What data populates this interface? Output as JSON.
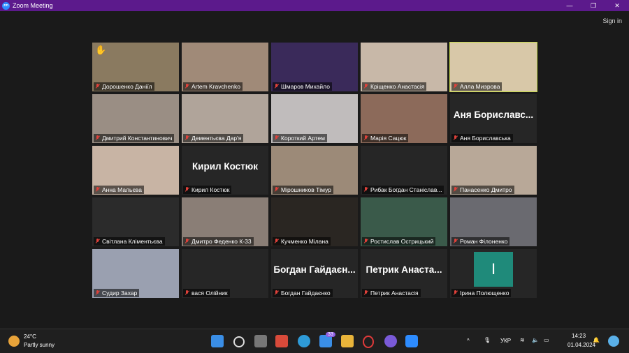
{
  "window": {
    "title": "Zoom Meeting",
    "signin": "Sign in"
  },
  "controls": {
    "minimize": "—",
    "maximize": "❐",
    "close": "✕"
  },
  "tiles": [
    {
      "name": "Дорошенко Даніїл",
      "hand": "✋",
      "bg": "#8a7a60"
    },
    {
      "name": "Artem Kravchenko",
      "bg": "#a08a78"
    },
    {
      "name": "Шмаров Михайло",
      "bg": "#3a2a5a"
    },
    {
      "name": "Кріщенко Анастасія",
      "bg": "#c8b8a8"
    },
    {
      "name": "Алла Миэрова",
      "bg": "#d8c8a8"
    },
    {
      "name": "Дмитрий Константинович",
      "bg": "#9a8e84"
    },
    {
      "name": "Дементьєва Дар'я",
      "bg": "#b0a49a"
    },
    {
      "name": "Короткий Артем",
      "bg": "#c0bcbc"
    },
    {
      "name": "Марія Сацюк",
      "bg": "#8c6a5a"
    },
    {
      "name": "Аня Бориславська",
      "big": "Аня Бориславс...",
      "bg": "#262626"
    },
    {
      "name": "Анна Мальєва",
      "bg": "#c8b4a4"
    },
    {
      "name": "Кирил Костюк",
      "big": "Кирил Костюк",
      "bg": "#262626"
    },
    {
      "name": "Мірошников Тімур",
      "bg": "#9c8a78"
    },
    {
      "name": "Рибак Богдан Станіслав...",
      "bg": "#262626"
    },
    {
      "name": "Панасенко Дмитро",
      "bg": "#b8a898"
    },
    {
      "name": "Світлана Кліментьєва",
      "bg": "#2b2b2b"
    },
    {
      "name": "Дмитро Феденко К-33",
      "bg": "#8a7e76"
    },
    {
      "name": "Кучменко Мілана",
      "bg": "#2a2622"
    },
    {
      "name": "Ростислав Острицький",
      "bg": "#3a5a4a"
    },
    {
      "name": "Роман Філоненко",
      "bg": "#6a6a70"
    },
    {
      "name": "Судир Захар",
      "bg": "#9aa0b0"
    },
    {
      "name": "вася Олійник",
      "bg": "#262626"
    },
    {
      "name": "Богдан Гайдаєнко",
      "big": "Богдан Гайдаєн...",
      "bg": "#262626"
    },
    {
      "name": "Петрик Анастасія",
      "big": "Петрик Анаста...",
      "bg": "#262626"
    },
    {
      "name": "Ірина Полющенко",
      "bg": "#262626",
      "avatar_letter": "І",
      "avatar_color": "#1f8a7a"
    }
  ],
  "taskbar": {
    "temp": "24°C",
    "weather": "Partly sunny",
    "mail_badge": "33",
    "lang": "УКР",
    "time": "14:23",
    "date": "01.04.2024"
  }
}
